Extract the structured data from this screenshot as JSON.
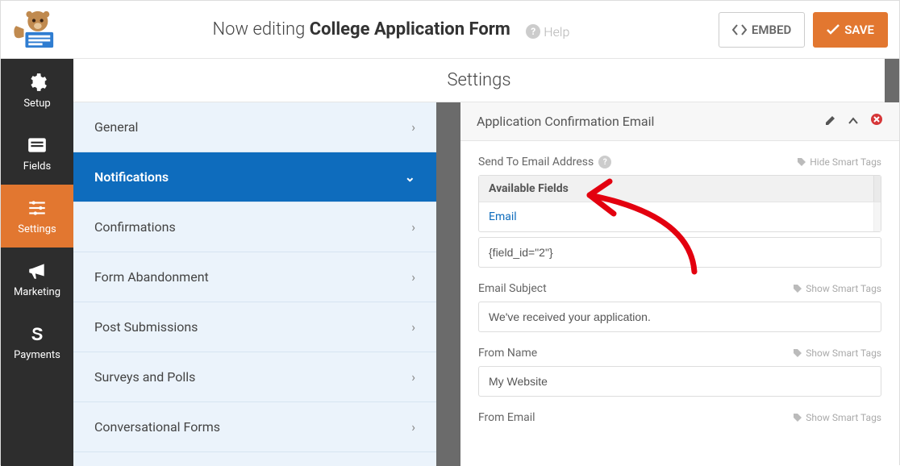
{
  "header": {
    "now_editing_prefix": "Now editing ",
    "form_name": "College Application Form",
    "help_label": "Help",
    "embed_label": "EMBED",
    "save_label": "SAVE"
  },
  "leftnav": [
    {
      "id": "setup",
      "label": "Setup"
    },
    {
      "id": "fields",
      "label": "Fields"
    },
    {
      "id": "settings",
      "label": "Settings"
    },
    {
      "id": "marketing",
      "label": "Marketing"
    },
    {
      "id": "payments",
      "label": "Payments"
    }
  ],
  "settings_panel": {
    "title": "Settings",
    "items": [
      {
        "label": "General",
        "active": false
      },
      {
        "label": "Notifications",
        "active": true
      },
      {
        "label": "Confirmations",
        "active": false
      },
      {
        "label": "Form Abandonment",
        "active": false
      },
      {
        "label": "Post Submissions",
        "active": false
      },
      {
        "label": "Surveys and Polls",
        "active": false
      },
      {
        "label": "Conversational Forms",
        "active": false
      }
    ]
  },
  "notification": {
    "card_title": "Application Confirmation Email",
    "send_to_label": "Send To Email Address",
    "hide_smart_tags": "Hide Smart Tags",
    "show_smart_tags": "Show Smart Tags",
    "available_fields_label": "Available Fields",
    "available_field_option": "Email",
    "send_to_value": "{field_id=\"2\"}",
    "email_subject_label": "Email Subject",
    "email_subject_value": "We've received your application.",
    "from_name_label": "From Name",
    "from_name_value": "My Website",
    "from_email_label": "From Email"
  }
}
